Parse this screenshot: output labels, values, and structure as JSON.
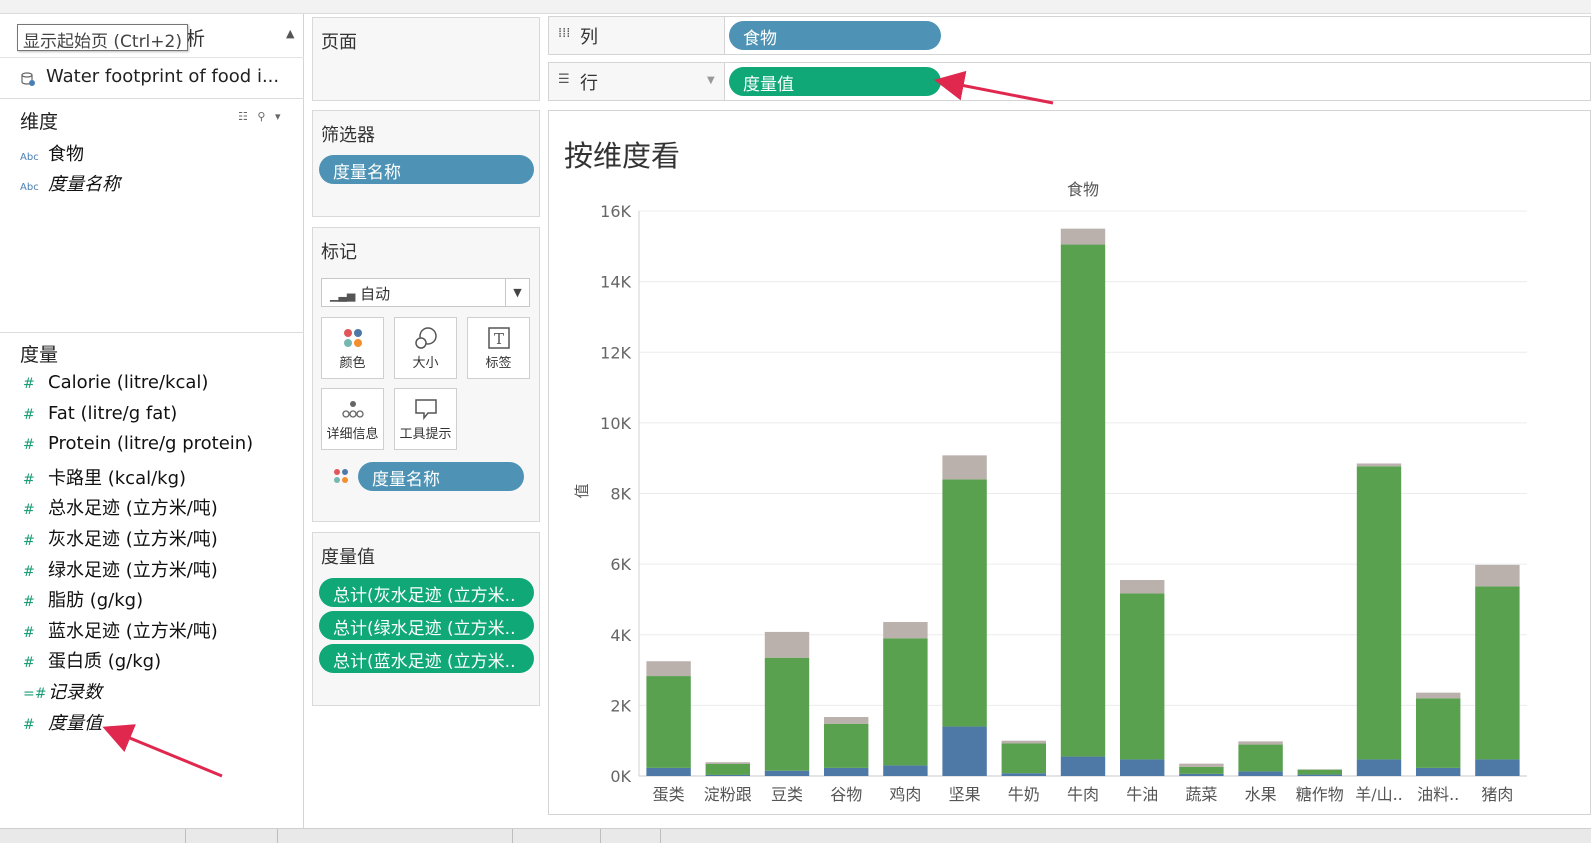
{
  "tooltip": "显示起始页 (Ctrl+2)",
  "data_tab_label": "析",
  "datasource": {
    "name": "Water footprint of food i..."
  },
  "dimensions": {
    "title": "维度",
    "items": [
      {
        "type": "Abc",
        "name": "食物",
        "italic": false
      },
      {
        "type": "Abc",
        "name": "度量名称",
        "italic": true
      }
    ]
  },
  "measures": {
    "title": "度量",
    "items": [
      {
        "type": "#",
        "name": "Calorie (litre/kcal)",
        "italic": false
      },
      {
        "type": "#",
        "name": "Fat (litre/g fat)",
        "italic": false
      },
      {
        "type": "#",
        "name": "Protein (litre/g protein)",
        "italic": false
      },
      {
        "type": "#",
        "name": "卡路里 (kcal/kg)",
        "italic": false
      },
      {
        "type": "#",
        "name": "总水足迹 (立方米/吨)",
        "italic": false
      },
      {
        "type": "#",
        "name": "灰水足迹 (立方米/吨)",
        "italic": false
      },
      {
        "type": "#",
        "name": "绿水足迹 (立方米/吨)",
        "italic": false
      },
      {
        "type": "#",
        "name": "脂肪 (g/kg)",
        "italic": false
      },
      {
        "type": "#",
        "name": "蓝水足迹 (立方米/吨)",
        "italic": false
      },
      {
        "type": "#",
        "name": "蛋白质 (g/kg)",
        "italic": false
      },
      {
        "type": "=#",
        "name": "记录数",
        "italic": true
      },
      {
        "type": "#",
        "name": "度量值",
        "italic": true
      }
    ]
  },
  "pages": {
    "title": "页面"
  },
  "filters": {
    "title": "筛选器",
    "pill": "度量名称"
  },
  "marks": {
    "title": "标记",
    "type": "自动",
    "buttons": {
      "color": "颜色",
      "size": "大小",
      "label": "标签",
      "detail": "详细信息",
      "tooltip": "工具提示"
    },
    "color_pill": "度量名称"
  },
  "measure_values": {
    "title": "度量值",
    "pills": [
      "总计(灰水足迹 (立方米..",
      "总计(绿水足迹 (立方米..",
      "总计(蓝水足迹 (立方米.."
    ]
  },
  "columns_shelf": {
    "label": "列",
    "pill": "食物"
  },
  "rows_shelf": {
    "label": "行",
    "pill": "度量值"
  },
  "viz": {
    "title": "按维度看"
  },
  "chart_data": {
    "type": "bar",
    "stacked": true,
    "xlabel": "食物",
    "ylabel": "值",
    "ylim": [
      0,
      16000
    ],
    "yticks": [
      0,
      2000,
      4000,
      6000,
      8000,
      10000,
      12000,
      14000,
      16000
    ],
    "ytick_labels": [
      "0K",
      "2K",
      "4K",
      "6K",
      "8K",
      "10K",
      "12K",
      "14K",
      "16K"
    ],
    "categories": [
      "蛋类",
      "淀粉跟",
      "豆类",
      "谷物",
      "鸡肉",
      "坚果",
      "牛奶",
      "牛肉",
      "牛油",
      "蔬菜",
      "水果",
      "糖作物",
      "羊/山..",
      "油料..",
      "猪肉"
    ],
    "series": [
      {
        "color": "#4e79a7",
        "values": [
          230,
          30,
          150,
          230,
          300,
          1400,
          80,
          550,
          470,
          60,
          130,
          40,
          470,
          230,
          470
        ]
      },
      {
        "color": "#59a14f",
        "values": [
          2600,
          310,
          3200,
          1250,
          3600,
          7000,
          840,
          14500,
          4700,
          200,
          760,
          140,
          8300,
          1970,
          4900
        ]
      },
      {
        "color": "#bab0ac",
        "values": [
          420,
          50,
          730,
          190,
          460,
          680,
          80,
          450,
          380,
          90,
          90,
          10,
          80,
          160,
          610
        ]
      }
    ],
    "grid": true,
    "legend": "none"
  },
  "colors": {
    "pill_blue": "#4e93b5",
    "pill_green": "#0fa876",
    "annotation_arrow": "#e0284f"
  }
}
